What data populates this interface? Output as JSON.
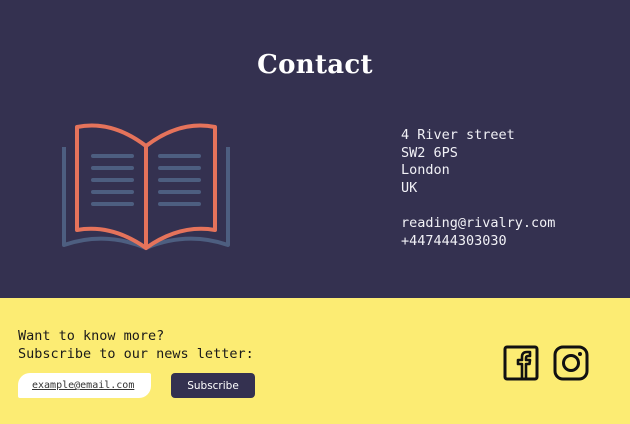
{
  "contact": {
    "title": "Contact",
    "address_lines": [
      "4 River street",
      "SW2 6PS",
      "London",
      "UK"
    ],
    "email": "reading@rivalry.com",
    "phone": "+447444303030"
  },
  "newsletter": {
    "line1": "Want to know more?",
    "line2": "Subscribe to our news letter:",
    "email_placeholder": "example@email.com",
    "subscribe_label": "Subscribe"
  },
  "social": [
    {
      "icon": "facebook-icon"
    },
    {
      "icon": "instagram-icon"
    }
  ],
  "colors": {
    "header_bg": "#343150",
    "footer_bg": "#fcec73",
    "book_page_outline": "#e5735b",
    "book_cover": "#4d5e80"
  }
}
